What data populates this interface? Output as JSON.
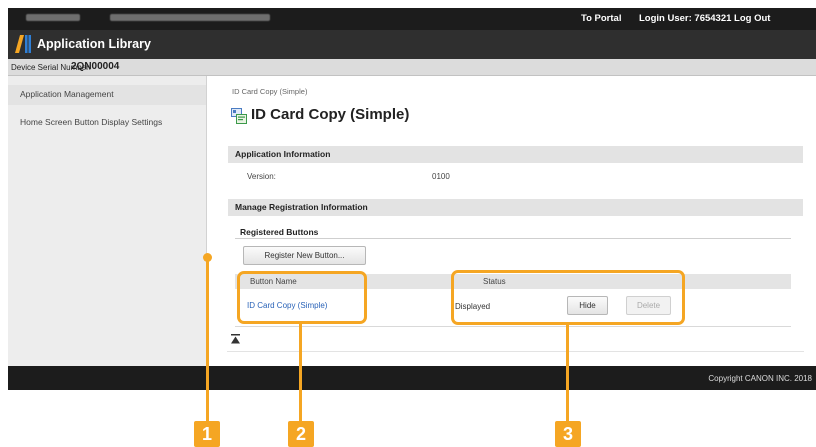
{
  "topbar": {
    "portal_link": "To Portal",
    "login_text": "Login User:  7654321  Log Out"
  },
  "header": {
    "app_title": "Application Library"
  },
  "serial": {
    "label": "Device Serial Number:",
    "value": "2QN00004"
  },
  "sidebar": {
    "items": [
      {
        "label": "Application Management"
      },
      {
        "label": "Home Screen Button Display Settings"
      }
    ]
  },
  "main": {
    "breadcrumb": "ID Card Copy (Simple)",
    "page_title": "ID Card Copy (Simple)",
    "app_info_section": "Application Information",
    "version_label": "Version:",
    "version_value": "0100",
    "manage_section": "Manage Registration Information",
    "registered_buttons_title": "Registered Buttons",
    "register_button": "Register New Button...",
    "table": {
      "columns": [
        "Button Name",
        "Status"
      ],
      "rows": [
        {
          "name": "ID Card Copy (Simple)",
          "status": "Displayed",
          "hide_label": "Hide",
          "delete_label": "Delete"
        }
      ]
    }
  },
  "footer": {
    "copyright": "Copyright CANON INC. 2018"
  },
  "callouts": [
    "1",
    "2",
    "3"
  ],
  "colors": {
    "callout": "#f5a623",
    "link": "#2a63b8",
    "topbar": "#1c1c1c"
  }
}
